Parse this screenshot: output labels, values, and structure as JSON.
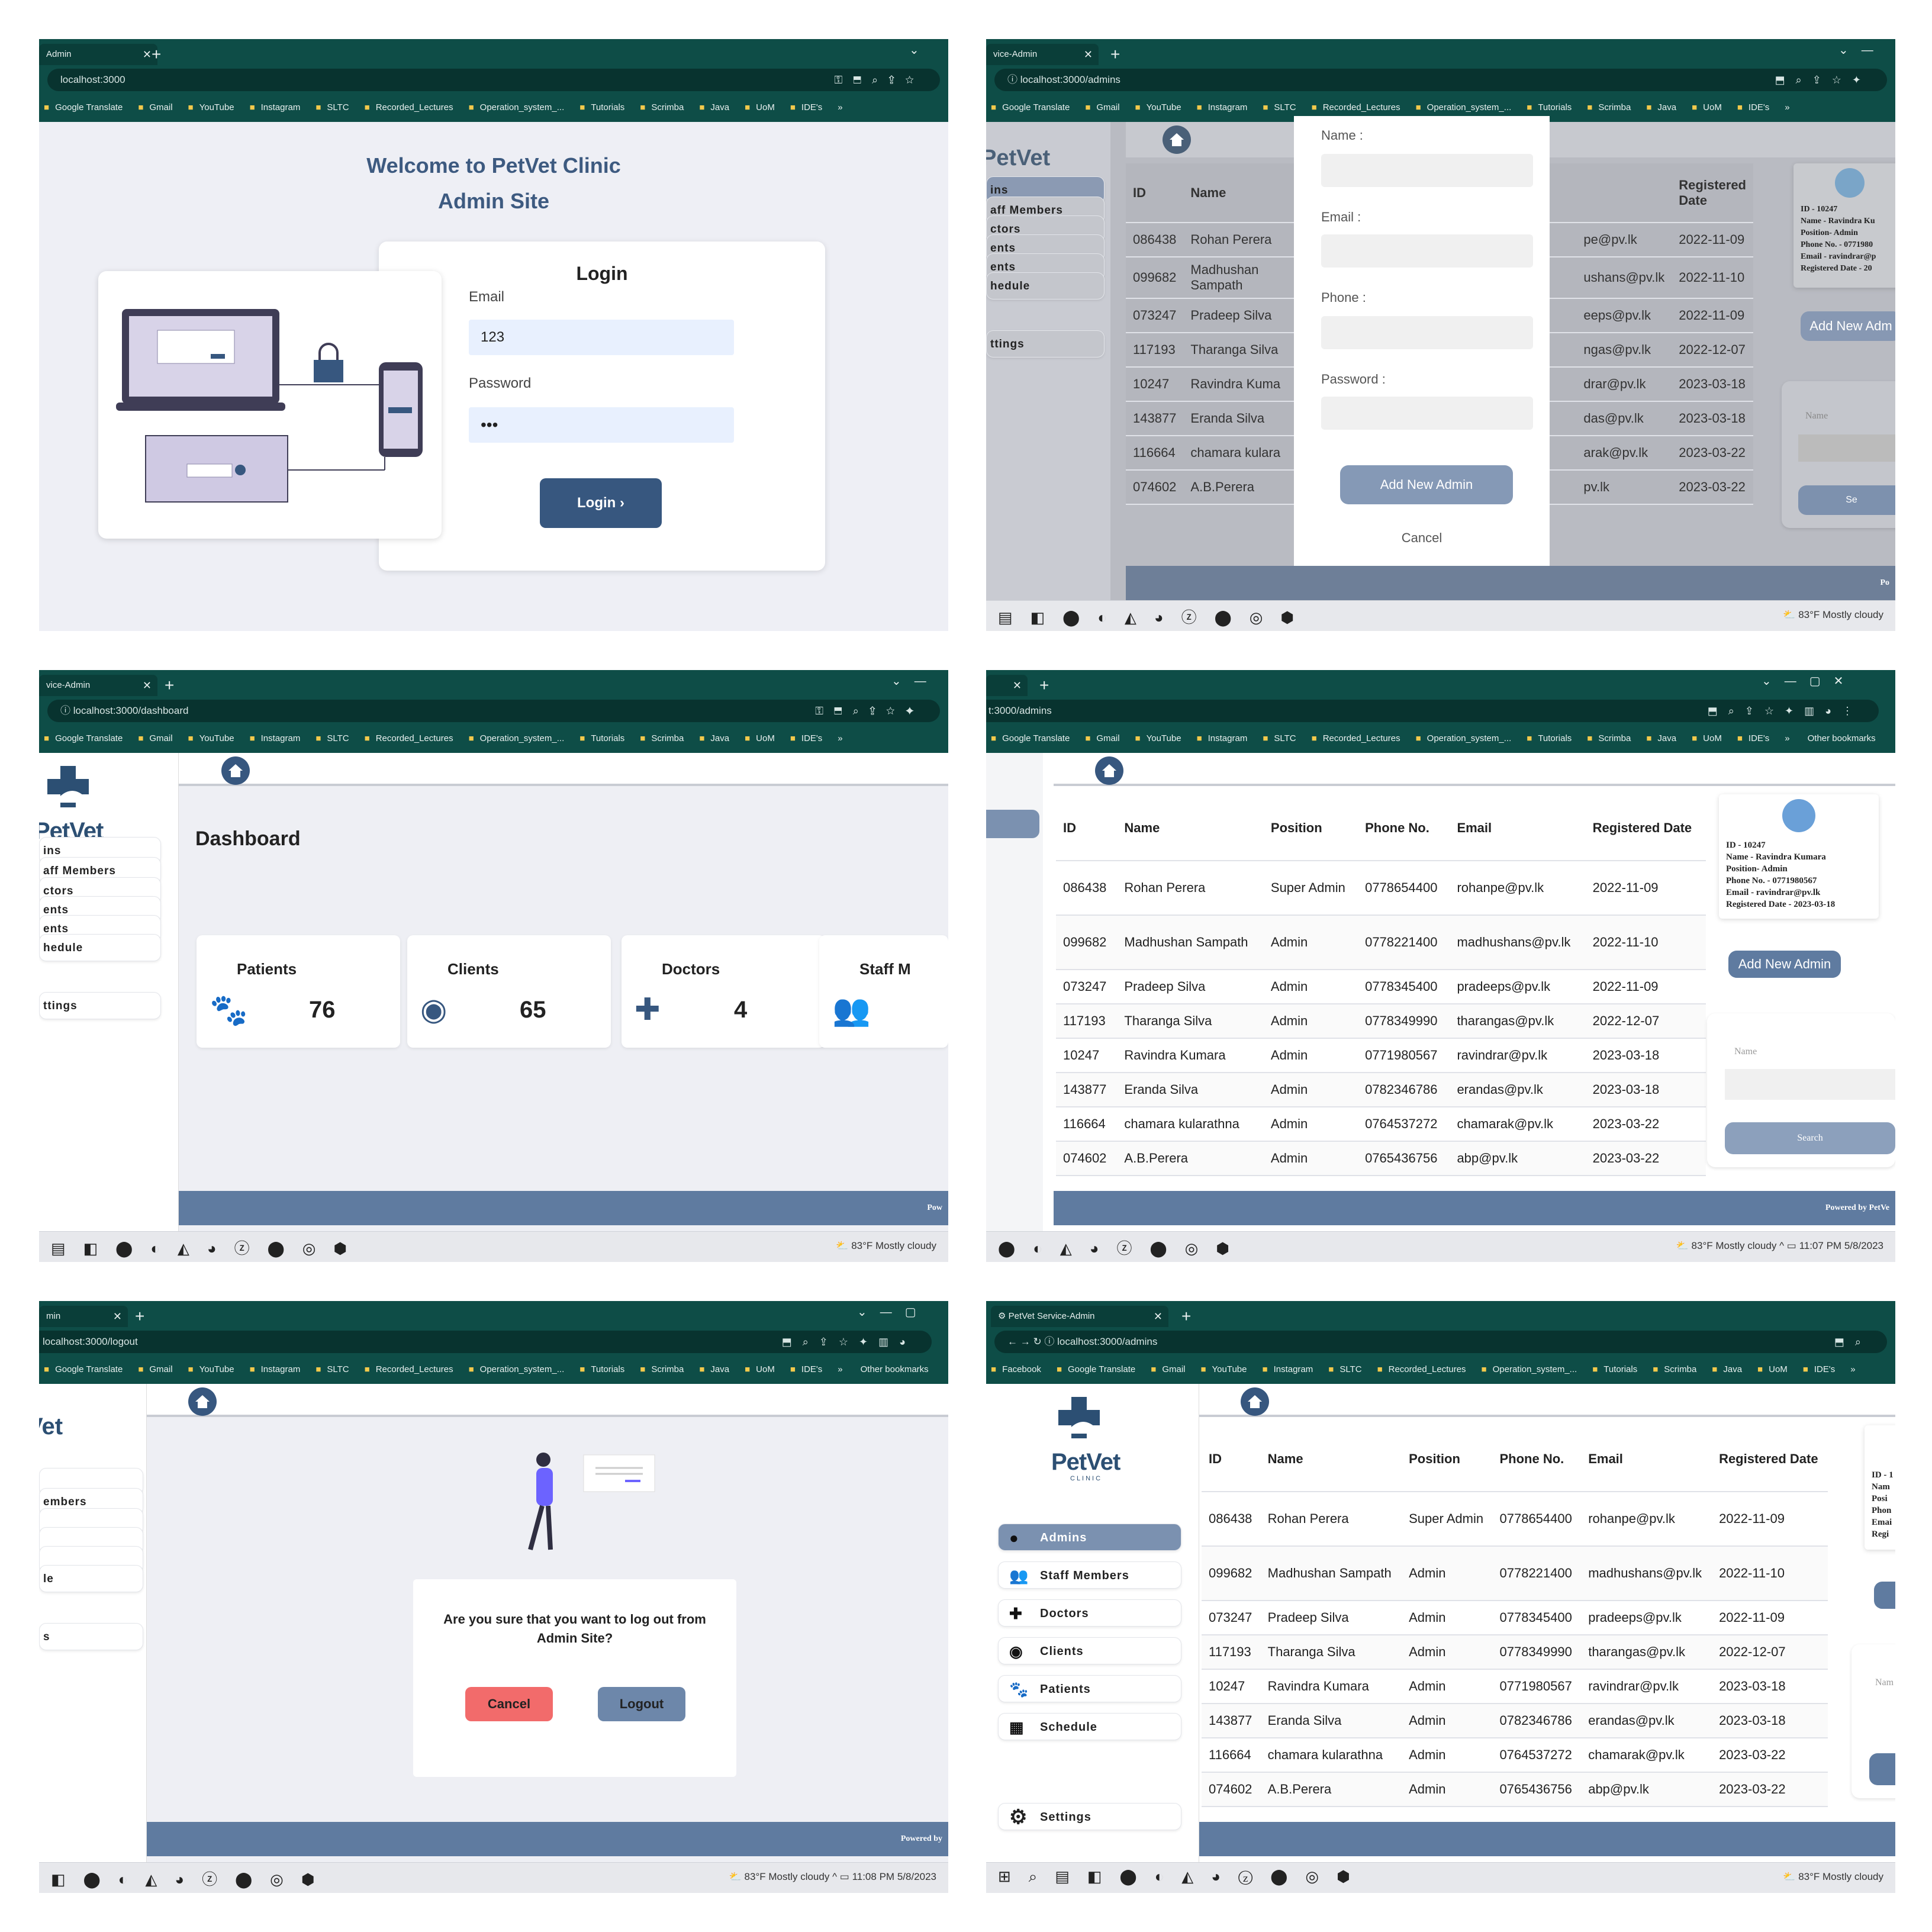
{
  "browser": {
    "bookmarks": [
      "Google Translate",
      "Gmail",
      "YouTube",
      "Instagram",
      "SLTC",
      "Recorded_Lectures",
      "Operation_system_...",
      "Tutorials",
      "Scrimba",
      "Java",
      "UoM",
      "IDE's"
    ],
    "other_bookmarks": "Other bookmarks",
    "more": "»"
  },
  "taskbar": {
    "weather": "83°F  Mostly cloudy",
    "time": "11:07 PM",
    "date": "5/8/2023",
    "time2": "11:08 PM"
  },
  "p1": {
    "tab": "Admin",
    "url": "localhost:3000",
    "welcome": "Welcome to PetVet Clinic",
    "welcome2": "Admin Site",
    "login_title": "Login",
    "email_label": "Email",
    "email_value": "123",
    "password_label": "Password",
    "password_value": "•••",
    "login_btn": "Login"
  },
  "p2": {
    "tab": "vice-Admin",
    "url": "localhost:3000/admins",
    "name_label": "Name :",
    "email_label": "Email :",
    "phone_label": "Phone :",
    "password_label": "Password :",
    "add_btn": "Add New Admin",
    "cancel": "Cancel",
    "side_items": [
      "ins",
      "aff Members",
      "ctors",
      "ents",
      "ents",
      "hedule",
      "ttings"
    ],
    "head": [
      "ID",
      "Name"
    ],
    "reg": [
      "Registered",
      "Date"
    ],
    "rows": [
      [
        "086438",
        "Rohan Perera",
        "pe@pv.lk",
        "2022-11-09"
      ],
      [
        "099682",
        "Madhushan Sampath",
        "ushans@pv.lk",
        "2022-11-10"
      ],
      [
        "073247",
        "Pradeep Silva",
        "eeps@pv.lk",
        "2022-11-09"
      ],
      [
        "117193",
        "Tharanga Silva",
        "ngas@pv.lk",
        "2022-12-07"
      ],
      [
        "10247",
        "Ravindra Kuma",
        "drar@pv.lk",
        "2023-03-18"
      ],
      [
        "143877",
        "Eranda Silva",
        "das@pv.lk",
        "2023-03-18"
      ],
      [
        "116664",
        "chamara kulara",
        "arak@pv.lk",
        "2023-03-22"
      ],
      [
        "074602",
        "A.B.Perera",
        "pv.lk",
        "2023-03-22"
      ]
    ],
    "profile": [
      "ID - 10247",
      "Name - Ravindra Ku",
      "Position- Admin",
      "Phone No. - 0771980",
      "Email - ravindrar@p",
      "Registered Date - 20"
    ],
    "add_new": "Add New Adm",
    "name_ph": "Name",
    "search": "Se",
    "footer": "Po"
  },
  "p3": {
    "tab": "vice-Admin",
    "url": "localhost:3000/dashboard",
    "title": "Dashboard",
    "side_items": [
      "ins",
      "aff Members",
      "ctors",
      "ents",
      "ents",
      "hedule",
      "ttings"
    ],
    "cards": [
      {
        "label": "Patients",
        "value": "76"
      },
      {
        "label": "Clients",
        "value": "65"
      },
      {
        "label": "Doctors",
        "value": "4"
      },
      {
        "label": "Staff M",
        "value": ""
      }
    ],
    "footer": "Pow"
  },
  "p4": {
    "tab": "t:3000/admins",
    "url": "t:3000/admins",
    "headers": [
      "ID",
      "Name",
      "Position",
      "Phone No.",
      "Email",
      "Registered Date"
    ],
    "rows": [
      [
        "086438",
        "Rohan Perera",
        "Super Admin",
        "0778654400",
        "rohanpe@pv.lk",
        "2022-11-09"
      ],
      [
        "099682",
        "Madhushan Sampath",
        "Admin",
        "0778221400",
        "madhushans@pv.lk",
        "2022-11-10"
      ],
      [
        "073247",
        "Pradeep Silva",
        "Admin",
        "0778345400",
        "pradeeps@pv.lk",
        "2022-11-09"
      ],
      [
        "117193",
        "Tharanga Silva",
        "Admin",
        "0778349990",
        "tharangas@pv.lk",
        "2022-12-07"
      ],
      [
        "10247",
        "Ravindra Kumara",
        "Admin",
        "0771980567",
        "ravindrar@pv.lk",
        "2023-03-18"
      ],
      [
        "143877",
        "Eranda Silva",
        "Admin",
        "0782346786",
        "erandas@pv.lk",
        "2023-03-18"
      ],
      [
        "116664",
        "chamara kularathna",
        "Admin",
        "0764537272",
        "chamarak@pv.lk",
        "2023-03-22"
      ],
      [
        "074602",
        "A.B.Perera",
        "Admin",
        "0765436756",
        "abp@pv.lk",
        "2023-03-22"
      ]
    ],
    "profile": [
      "ID - 10247",
      "Name - Ravindra Kumara",
      "Position- Admin",
      "Phone No. - 0771980567",
      "Email - ravindrar@pv.lk",
      "Registered Date - 2023-03-18"
    ],
    "add_new": "Add New Admin",
    "name_ph": "Name",
    "search": "Search",
    "footer": "Powered by PetVe"
  },
  "p5": {
    "tab": "min",
    "url": "localhost:3000/logout",
    "side_items": [
      "",
      "embers",
      "",
      "",
      "",
      "le",
      "s"
    ],
    "question": "Are you sure that you want to log out from Admin Site?",
    "cancel": "Cancel",
    "logout": "Logout",
    "footer": "Powered by"
  },
  "p6": {
    "tab": "PetVet Service-Admin",
    "url": "localhost:3000/admins",
    "first_bookmark": "Facebook",
    "nav": [
      "Admins",
      "Staff Members",
      "Doctors",
      "Clients",
      "Patients",
      "Schedule"
    ],
    "settings": "Settings",
    "headers": [
      "ID",
      "Name",
      "Position",
      "Phone No.",
      "Email",
      "Registered Date"
    ],
    "rows": [
      [
        "086438",
        "Rohan Perera",
        "Super Admin",
        "0778654400",
        "rohanpe@pv.lk",
        "2022-11-09"
      ],
      [
        "099682",
        "Madhushan Sampath",
        "Admin",
        "0778221400",
        "madhushans@pv.lk",
        "2022-11-10"
      ],
      [
        "073247",
        "Pradeep Silva",
        "Admin",
        "0778345400",
        "pradeeps@pv.lk",
        "2022-11-09"
      ],
      [
        "117193",
        "Tharanga Silva",
        "Admin",
        "0778349990",
        "tharangas@pv.lk",
        "2022-12-07"
      ],
      [
        "10247",
        "Ravindra Kumara",
        "Admin",
        "0771980567",
        "ravindrar@pv.lk",
        "2023-03-18"
      ],
      [
        "143877",
        "Eranda Silva",
        "Admin",
        "0782346786",
        "erandas@pv.lk",
        "2023-03-18"
      ],
      [
        "116664",
        "chamara kularathna",
        "Admin",
        "0764537272",
        "chamarak@pv.lk",
        "2023-03-22"
      ],
      [
        "074602",
        "A.B.Perera",
        "Admin",
        "0765436756",
        "abp@pv.lk",
        "2023-03-22"
      ]
    ],
    "profile": [
      "ID - 1",
      "Nam",
      "Posi",
      "Phon",
      "Emai",
      "Regi"
    ],
    "name_ph": "Nam"
  },
  "logo": {
    "text": "PetVet",
    "sub": "CLINIC"
  },
  "colors": {
    "chrome": "#0e4d47",
    "accent": "#37577f",
    "button": "#5f7ba0",
    "cancel": "#f26b6b"
  }
}
